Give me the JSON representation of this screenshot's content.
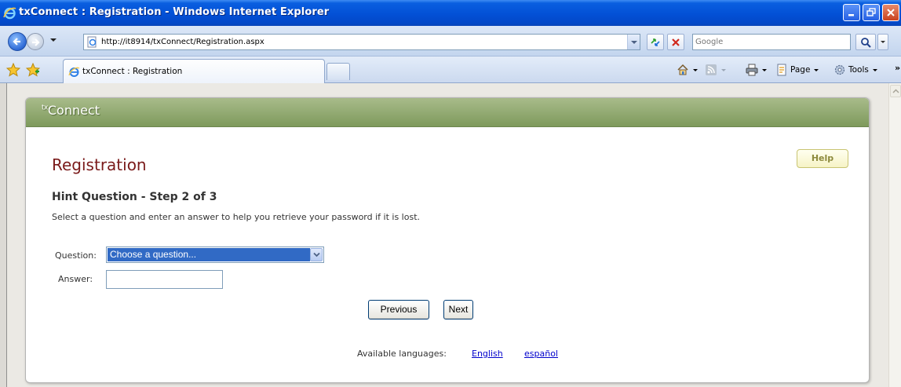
{
  "window": {
    "title": "txConnect : Registration - Windows Internet Explorer"
  },
  "address": {
    "url": "http://it8914/txConnect/Registration.aspx",
    "search_placeholder": "Google"
  },
  "tabs": {
    "active_label": "txConnect : Registration"
  },
  "commands": {
    "page_label": "Page",
    "tools_label": "Tools",
    "overflow": "»"
  },
  "app": {
    "brand_prefix": "tx",
    "brand_name": "Connect",
    "help_label": "Help"
  },
  "form": {
    "page_title": "Registration",
    "step_title": "Hint Question - Step 2 of 3",
    "instructions": "Select a question and enter an answer to help you retrieve your password if it is lost.",
    "question_label": "Question:",
    "question_selected": "Choose a question...",
    "answer_label": "Answer:",
    "answer_value": "",
    "previous_label": "Previous",
    "next_label": "Next"
  },
  "languages": {
    "label": "Available languages:",
    "items": [
      "English",
      "español"
    ]
  },
  "colors": {
    "titlebar_blue": "#0350d6",
    "header_green": "#8fa86e",
    "title_red": "#7a1a1a",
    "link_blue": "#0000cc",
    "selection_blue": "#316ac5"
  }
}
